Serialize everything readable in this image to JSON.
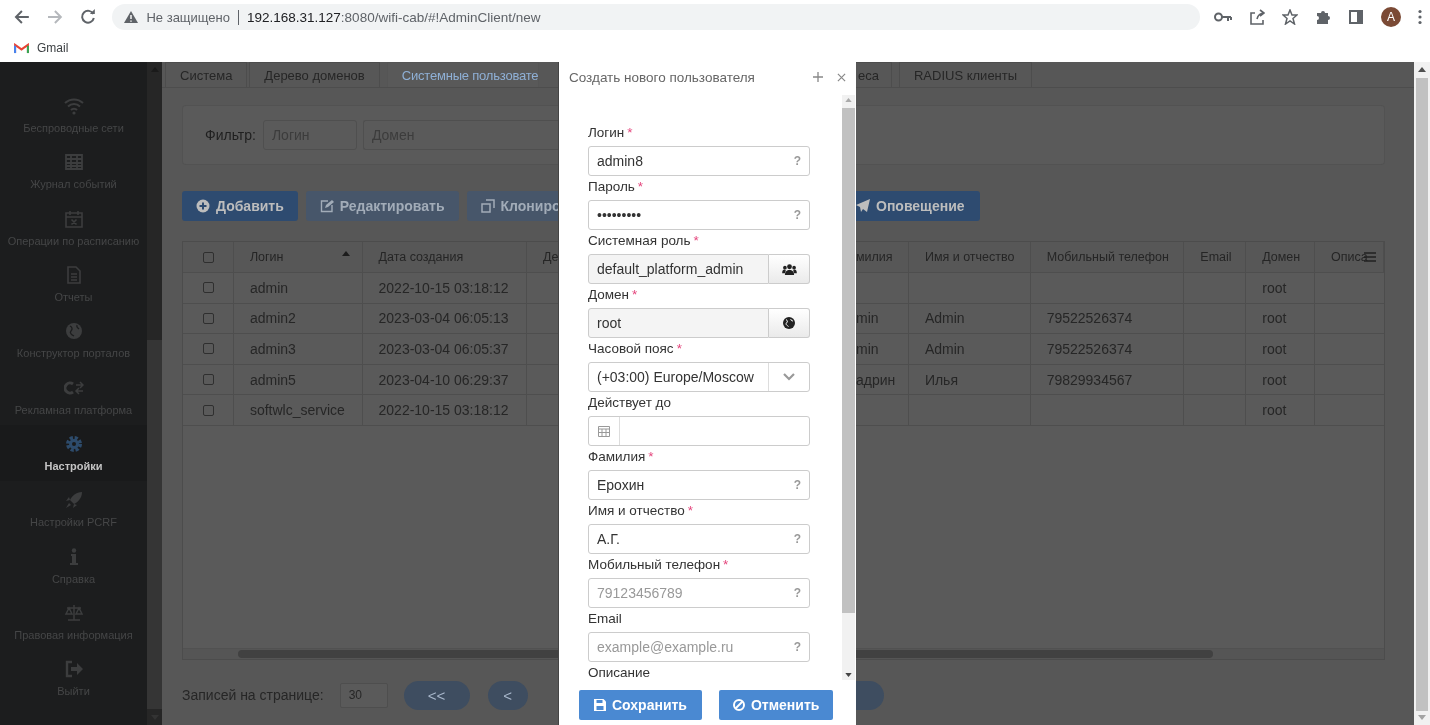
{
  "browser": {
    "security_label": "Не защищено",
    "url_host": "192.168.31.127",
    "url_path": ":8080/wifi-cab/#!AdminClient/new",
    "profile_initial": "A",
    "bookmarks": [
      {
        "label": "Gmail"
      }
    ]
  },
  "sidebar": {
    "items": [
      {
        "label": "Беспроводные сети",
        "selected": false
      },
      {
        "label": "Журнал событий",
        "selected": false
      },
      {
        "label": "Операции по расписанию",
        "selected": false
      },
      {
        "label": "Отчеты",
        "selected": false
      },
      {
        "label": "Конструктор порталов",
        "selected": false
      },
      {
        "label": "Рекламная платформа",
        "selected": false
      },
      {
        "label": "Настройки",
        "selected": true
      },
      {
        "label": "Настройки PCRF",
        "selected": false
      },
      {
        "label": "Справка",
        "selected": false
      },
      {
        "label": "Правовая информация",
        "selected": false
      },
      {
        "label": "Выйти",
        "selected": false
      }
    ]
  },
  "tabs": [
    {
      "label": "Система",
      "selected": false
    },
    {
      "label": "Дерево доменов",
      "selected": false
    },
    {
      "label": "Системные пользовате",
      "selected": true
    },
    {
      "label": "еса",
      "selected": false
    },
    {
      "label": "RADIUS клиенты",
      "selected": false
    }
  ],
  "filter": {
    "label": "Фильтр:",
    "fields": [
      {
        "placeholder": "Логин"
      },
      {
        "placeholder": "Домен"
      }
    ]
  },
  "toolbar": [
    {
      "label": "Добавить",
      "disabled": false
    },
    {
      "label": "Редактировать",
      "disabled": true
    },
    {
      "label": "Клониро",
      "disabled": true
    },
    {
      "label": "Оповещение",
      "disabled": false
    }
  ],
  "table": {
    "select_all_checked": false,
    "columns": [
      {
        "label": "Логин",
        "sorted": true
      },
      {
        "label": "Дата создания"
      },
      {
        "label": "Де"
      },
      {
        "label": "милия"
      },
      {
        "label": "Имя и отчество"
      },
      {
        "label": "Мобильный телефон"
      },
      {
        "label": "Email"
      },
      {
        "label": "Домен"
      },
      {
        "label": "Описа"
      }
    ],
    "rows": [
      {
        "checked": false,
        "login": "admin",
        "created": "2022-10-15 03:18:12",
        "domain": "root"
      },
      {
        "checked": false,
        "login": "admin2",
        "created": "2023-03-04 06:05:13",
        "surname": "min",
        "given_names": "Admin",
        "phone": "79522526374",
        "domain": "root"
      },
      {
        "checked": false,
        "login": "admin3",
        "created": "2023-03-04 06:05:37",
        "surname": "min",
        "given_names": "Admin",
        "phone": "79522526374",
        "domain": "root"
      },
      {
        "checked": false,
        "login": "admin5",
        "created": "2023-04-10 06:29:37",
        "surname": "адрин",
        "given_names": "Илья",
        "phone": "79829934567",
        "domain": "root"
      },
      {
        "checked": false,
        "login": "softwlc_service",
        "created": "2022-10-15 03:18:12",
        "domain": "root"
      }
    ]
  },
  "pagination": {
    "label": "Записей на странице:",
    "page_size": "30",
    "buttons": [
      {
        "label": "<<"
      },
      {
        "label": "<"
      }
    ]
  },
  "dialog": {
    "title": "Создать нового пользователя",
    "required_mark": "*",
    "buttons": [
      {
        "label": "Сохранить",
        "kind": "save"
      },
      {
        "label": "Отменить",
        "kind": "cancel"
      }
    ],
    "fields": [
      {
        "label": "Логин",
        "required": true,
        "kind": "text",
        "value": "admin8",
        "help": "?"
      },
      {
        "label": "Пароль",
        "required": true,
        "kind": "text",
        "value": "•••••••••",
        "help": "?"
      },
      {
        "label": "Системная роль",
        "required": true,
        "kind": "role",
        "value": "default_platform_admin"
      },
      {
        "label": "Домен",
        "required": true,
        "kind": "domain",
        "value": "root"
      },
      {
        "label": "Часовой пояс",
        "required": true,
        "kind": "select",
        "value": "(+03:00) Europe/Moscow"
      },
      {
        "label": "Действует до",
        "required": false,
        "kind": "date"
      },
      {
        "label": "Фамилия",
        "required": true,
        "kind": "text",
        "value": "Ерохин",
        "help": "?"
      },
      {
        "label": "Имя и отчество",
        "required": true,
        "kind": "text",
        "value": "А.Г.",
        "help": "?"
      },
      {
        "label": "Мобильный телефон",
        "required": true,
        "kind": "text",
        "placeholder": "79123456789",
        "help": "?"
      },
      {
        "label": "Email",
        "required": false,
        "kind": "text",
        "placeholder": "example@example.ru",
        "help": "?"
      },
      {
        "label": "Описание",
        "required": false,
        "kind": "label"
      }
    ]
  }
}
